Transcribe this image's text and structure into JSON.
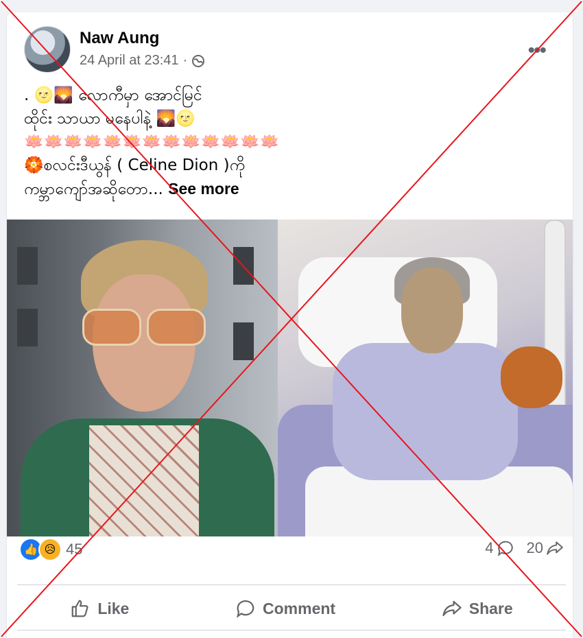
{
  "post": {
    "author": "Naw Aung",
    "timestamp": "24 April at 23:41",
    "separator": "·",
    "text_lines": [
      ". 🌝🌄 လောကီမှာ အောင်မြင်",
      "          ထိုင်း သာယာ မနေပါနဲ့ 🌄🌝",
      "🪷🪷🪷🪷🪷🪷🪷🪷🪷🪷🪷🪷🪷",
      "🏵️စလင်းဒီယွန် ( Celine Dion )ကို",
      "ကမ္ဘာကျော်အဆိုတော..."
    ],
    "see_more": "See more"
  },
  "stats": {
    "reaction_count": "45",
    "comments": "4",
    "shares": "20"
  },
  "actions": {
    "like": "Like",
    "comment": "Comment",
    "share": "Share"
  },
  "icons": {
    "more": "more-options-icon",
    "privacy": "globe-icon",
    "like_reaction": "like-reaction-icon",
    "sad_reaction": "sad-reaction-icon"
  },
  "colors": {
    "facebook_blue": "#1877f2",
    "overlay_red": "#e8141b",
    "muted_text": "#65676b"
  }
}
